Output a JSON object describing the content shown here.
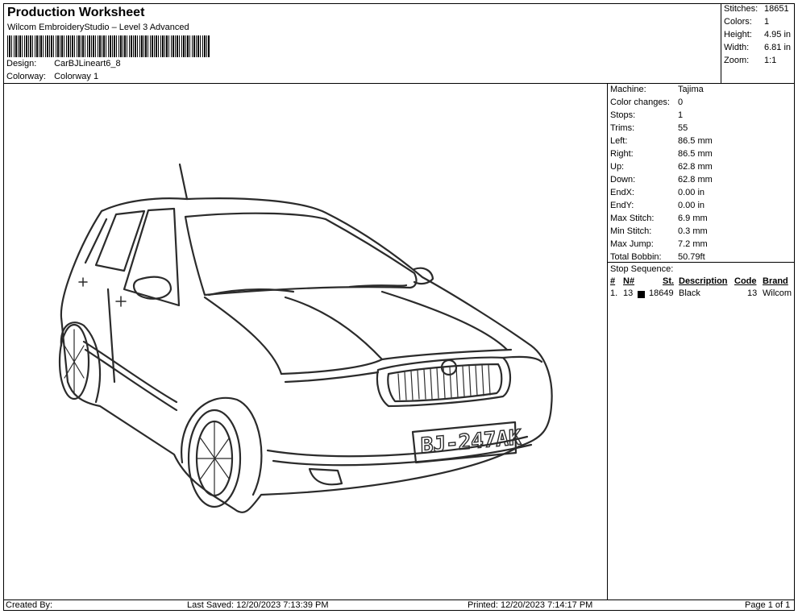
{
  "header": {
    "title": "Production Worksheet",
    "software": "Wilcom EmbroideryStudio – Level 3 Advanced",
    "design_label": "Design:",
    "design_value": "CarBJLineart6_8",
    "colorway_label": "Colorway:",
    "colorway_value": "Colorway 1"
  },
  "summary": {
    "stitches_label": "Stitches:",
    "stitches_value": "18651",
    "colors_label": "Colors:",
    "colors_value": "1",
    "height_label": "Height:",
    "height_value": "4.95 in",
    "width_label": "Width:",
    "width_value": "6.81 in",
    "zoom_label": "Zoom:",
    "zoom_value": "1:1"
  },
  "machine": {
    "rows": [
      {
        "k": "Machine:",
        "v": "Tajima"
      },
      {
        "k": "Color changes:",
        "v": "0"
      },
      {
        "k": "Stops:",
        "v": "1"
      },
      {
        "k": "Trims:",
        "v": "55"
      },
      {
        "k": "Left:",
        "v": "86.5 mm"
      },
      {
        "k": "Right:",
        "v": "86.5 mm"
      },
      {
        "k": "Up:",
        "v": "62.8 mm"
      },
      {
        "k": "Down:",
        "v": "62.8 mm"
      },
      {
        "k": "EndX:",
        "v": "0.00 in"
      },
      {
        "k": "EndY:",
        "v": "0.00 in"
      },
      {
        "k": "Max Stitch:",
        "v": "6.9 mm"
      },
      {
        "k": "Min Stitch:",
        "v": "0.3 mm"
      },
      {
        "k": "Max Jump:",
        "v": "7.2 mm"
      },
      {
        "k": "Total Bobbin:",
        "v": "50.79ft"
      }
    ]
  },
  "sequence": {
    "label": "Stop Sequence:",
    "headers": {
      "num": "#",
      "n": "N#",
      "st": "St.",
      "desc": "Description",
      "code": "Code",
      "brand": "Brand"
    },
    "rows": [
      {
        "num": "1.",
        "n": "13",
        "st": "18649",
        "desc": "Black",
        "code": "13",
        "brand": "Wilcom",
        "color": "#000000"
      }
    ]
  },
  "artwork": {
    "plate_text": "BJ-247AK",
    "line_color": "#2b2b2b"
  },
  "footer": {
    "created": "Created By:",
    "saved": "Last Saved: 12/20/2023 7:13:39 PM",
    "printed": "Printed: 12/20/2023 7:14:17 PM",
    "page": "Page 1 of 1"
  }
}
